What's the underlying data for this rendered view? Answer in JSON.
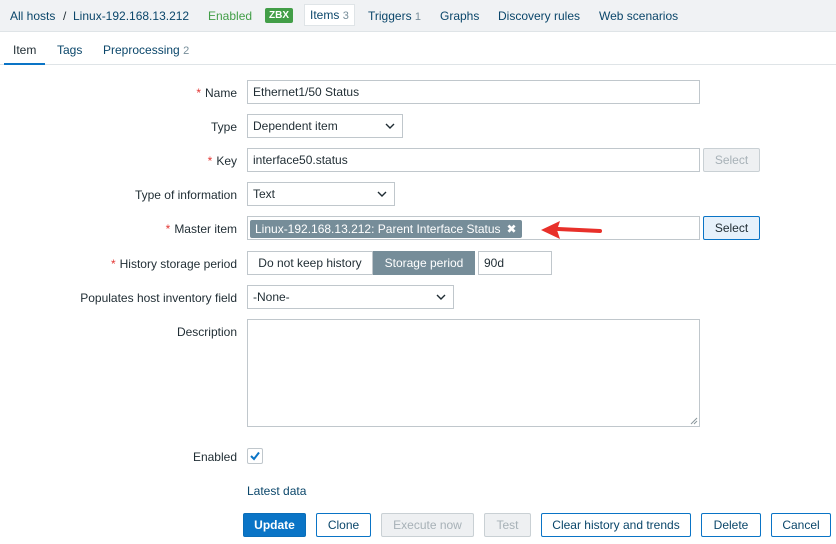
{
  "host_nav": {
    "all_hosts": "All hosts",
    "separator": "/",
    "host_name": "Linux-192.168.13.212",
    "status": "Enabled",
    "zbx_badge": "ZBX",
    "items_label": "Items",
    "items_count": "3",
    "triggers_label": "Triggers",
    "triggers_count": "1",
    "graphs_label": "Graphs",
    "discovery_label": "Discovery rules",
    "web_label": "Web scenarios"
  },
  "tabs": {
    "item": "Item",
    "tags": "Tags",
    "preprocessing": "Preprocessing",
    "preprocessing_count": "2"
  },
  "form": {
    "required_mark": "*",
    "name_label": "Name",
    "name_value": "Ethernet1/50 Status",
    "type_label": "Type",
    "type_value": "Dependent item",
    "key_label": "Key",
    "key_value": "interface50.status",
    "key_select": "Select",
    "type_info_label": "Type of information",
    "type_info_value": "Text",
    "master_label": "Master item",
    "master_value": "Linux-192.168.13.212: Parent Interface Status",
    "master_remove": "✖",
    "master_select": "Select",
    "history_label": "History storage period",
    "history_opt_1": "Do not keep history",
    "history_opt_2": "Storage period",
    "history_value": "90d",
    "inventory_label": "Populates host inventory field",
    "inventory_value": "-None-",
    "description_label": "Description",
    "description_value": "",
    "enabled_label": "Enabled",
    "enabled_checked": true,
    "latest_data": "Latest data"
  },
  "buttons": {
    "update": "Update",
    "clone": "Clone",
    "execute_now": "Execute now",
    "test": "Test",
    "clear_history": "Clear history and trends",
    "delete": "Delete",
    "cancel": "Cancel"
  },
  "colors": {
    "link": "#0a466a",
    "primary": "#0a74c6",
    "enabled": "#429e47",
    "required": "#e33734",
    "annotation_arrow": "#e8302a"
  }
}
